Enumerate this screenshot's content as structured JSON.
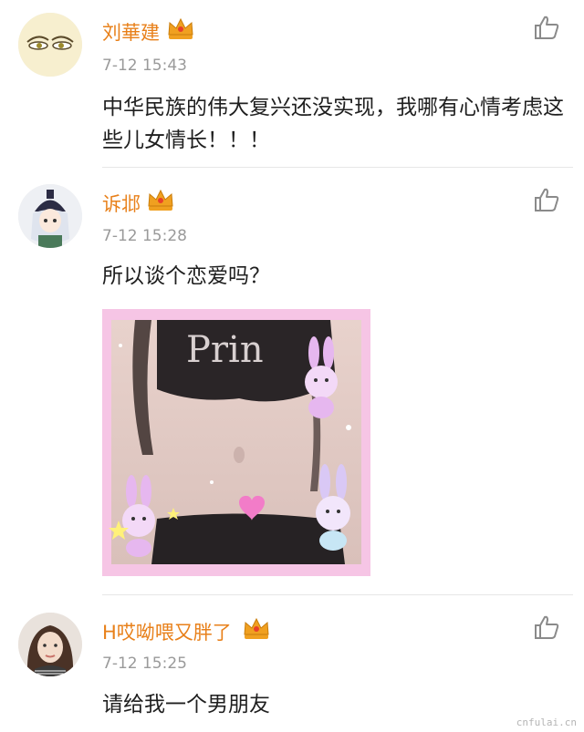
{
  "comments": [
    {
      "username": "刘華建",
      "time": "7-12 15:43",
      "text": "中华民族的伟大复兴还没实现，我哪有心情考虑这些儿女情长！！！"
    },
    {
      "username": "诉邶",
      "time": "7-12 15:28",
      "text": "所以谈个恋爱吗？",
      "image_text": "Prin"
    },
    {
      "username": "H哎呦喂又胖了",
      "time": "7-12 15:25",
      "text": "请给我一个男朋友"
    }
  ],
  "watermark": "cnfulai.cn",
  "colors": {
    "username": "#e8801a",
    "time": "#9a9a9a",
    "crown": "#f0a020",
    "text": "#1f1f1f"
  }
}
